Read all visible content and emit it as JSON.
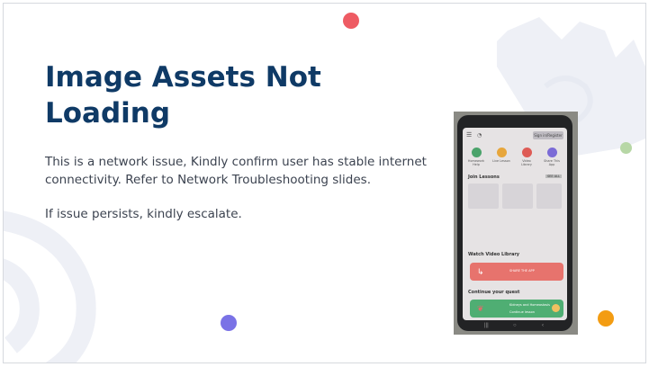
{
  "slide": {
    "title": "Image Assets Not Loading",
    "paragraph1": "This is a network issue, Kindly confirm user has stable internet connectivity. Refer to Network Troubleshooting slides.",
    "paragraph2": "If issue persists, kindly escalate."
  },
  "phone_screen": {
    "login_label": "Sign in/Register",
    "quick_actions": [
      {
        "label": "Homework Help",
        "color": "#4ba36b"
      },
      {
        "label": "Live Lesson",
        "color": "#e7a63c"
      },
      {
        "label": "Video Library",
        "color": "#de5b55"
      },
      {
        "label": "Share This App",
        "color": "#7b6bd6"
      }
    ],
    "section_join": "Join Lessons",
    "see_all": "SEE ALL",
    "section_video": "Watch Video Library",
    "section_continue": "Continue your quest",
    "red_banner_text": "SHARE THE APP",
    "green_banner_title": "Kidneys and Homeostasis",
    "green_banner_sub": "Continue lesson"
  },
  "colors": {
    "title": "#0f3a66",
    "body_text": "#3c4350",
    "dot_red": "#ee5b63",
    "dot_green": "#b7d7a6",
    "dot_purple": "#7a72e6",
    "dot_orange": "#f39c12",
    "deco": "#eef0f6"
  }
}
